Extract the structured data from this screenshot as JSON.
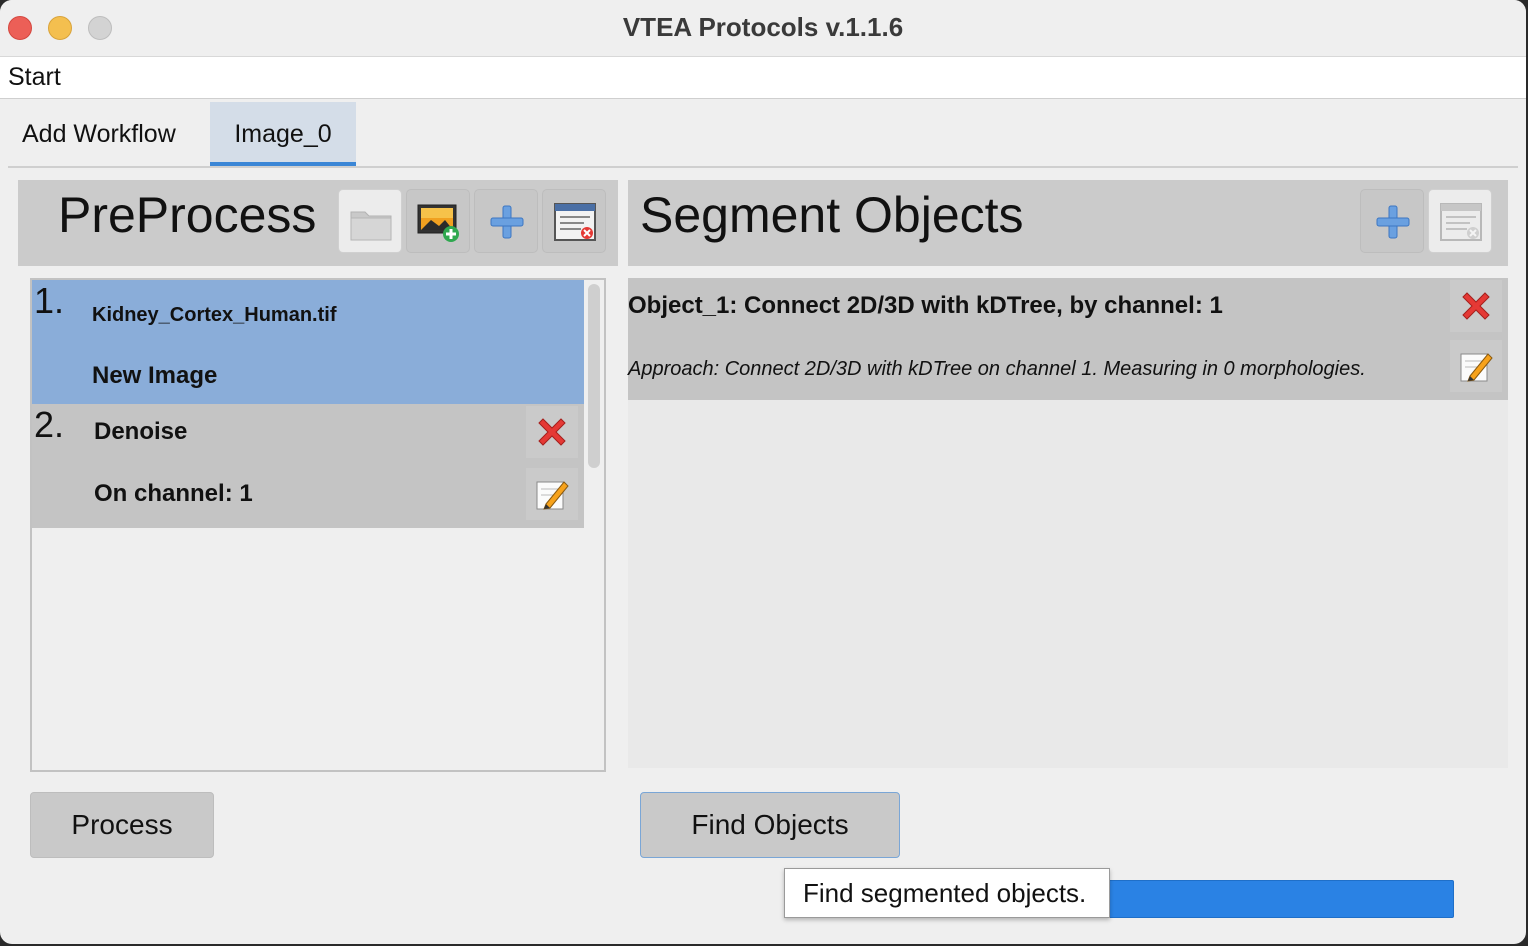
{
  "window": {
    "title": "VTEA Protocols v.1.1.6"
  },
  "menubar": {
    "start": "Start"
  },
  "tabs": [
    {
      "label": "Add Workflow"
    },
    {
      "label": "Image_0"
    }
  ],
  "preprocess": {
    "title": "PreProcess",
    "toolbar": [
      "folder-icon",
      "add-image-icon",
      "add-step-icon",
      "clear-steps-icon"
    ],
    "steps": [
      {
        "number": "1.",
        "line1": "Kidney_Cortex_Human.tif",
        "line2": "New Image"
      },
      {
        "number": "2.",
        "line1": "Denoise",
        "line2": "On channel: 1"
      }
    ],
    "process_label": "Process"
  },
  "segment": {
    "title": "Segment Objects",
    "toolbar": [
      "add-step-icon",
      "clear-steps-icon"
    ],
    "objects": [
      {
        "title": "Object_1: Connect 2D/3D with kDTree, by channel: 1",
        "approach": "Approach: Connect 2D/3D with kDTree on channel 1.  Measuring in 0 morphologies."
      }
    ],
    "find_label": "Find Objects"
  },
  "tooltip": {
    "text": "Find segmented objects."
  },
  "progress": {
    "value": 1.0
  },
  "colors": {
    "selected_row": "#8aadd9",
    "row": "#c4c4c4",
    "progress": "#2a82e4",
    "tab_underline": "#3a86d6"
  }
}
